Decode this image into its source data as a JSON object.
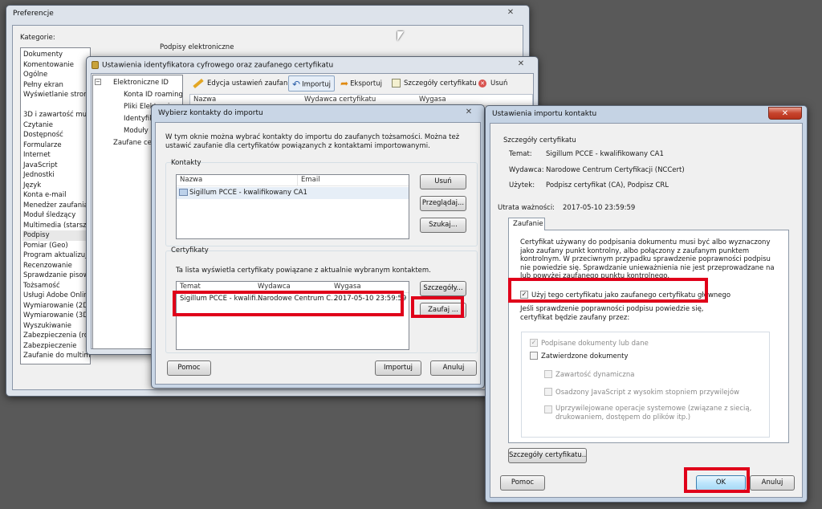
{
  "pref_window": {
    "title": "Preferencje",
    "categories_label": "Kategorie:",
    "categories": [
      "Dokumenty",
      "Komentowanie",
      "Ogólne",
      "Pełny ekran",
      "Wyświetlanie strony",
      "",
      "3D i zawartość multim",
      "Czytanie",
      "Dostępność",
      "Formularze",
      "Internet",
      "JavaScript",
      "Jednostki",
      "Język",
      "Konta e-mail",
      "Menedżer zaufania",
      "Moduł śledzący",
      "Multimedia (starsze)",
      "Podpisy",
      "Pomiar (Geo)",
      "Program aktualizujący",
      "Recenzowanie",
      "Sprawdzanie pisowni",
      "Tożsamość",
      "Usługi Adobe Online",
      "Wymiarowanie (2D)",
      "Wymiarowanie (3D)",
      "Wyszukiwanie",
      "Zabezpieczenia (rozsz",
      "Zabezpieczenie",
      "Zaufanie do multimed"
    ],
    "selected_category": "Podpisy",
    "section_title": "Podpisy elektroniczne"
  },
  "id_window": {
    "title": "Ustawienia identyfikatora cyfrowego oraz zaufanego certyfikatu",
    "tree": [
      "Elektroniczne ID",
      "Konta ID roamingu",
      "Pliki Elektroniczne ID",
      "Identyfikatory",
      "Moduły i ż",
      "Zaufane certy"
    ],
    "toolbar": {
      "edit": "Edycja ustawień zaufania",
      "import": "Importuj",
      "export": "Eksportuj",
      "details": "Szczegóły certyfikatu",
      "remove": "Usuń"
    },
    "columns": [
      "Nazwa",
      "Wydawca certyfikatu",
      "Wygasa"
    ]
  },
  "import_window": {
    "title": "Wybierz kontakty do importu",
    "intro": "W tym oknie można wybrać kontakty do importu do zaufanych tożsamości. Można też ustawić zaufanie dla certyfikatów powiązanych z kontaktami importowanymi.",
    "contacts_label": "Kontakty",
    "contacts_columns": [
      "Nazwa",
      "Email"
    ],
    "contacts": [
      {
        "name": "Sigillum PCCE - kwalifikowany CA1",
        "email": ""
      }
    ],
    "btn_remove": "Usuń",
    "btn_browse": "Przeglądaj...",
    "btn_search": "Szukaj...",
    "certs_label": "Certyfikaty",
    "certs_desc": "Ta lista wyświetla certyfikaty powiązane z aktualnie wybranym kontaktem.",
    "certs_columns": [
      "Temat",
      "Wydawca",
      "Wygasa"
    ],
    "certs": [
      {
        "subject": "Sigillum PCCE - kwalifi...",
        "issuer": "Narodowe Centrum C...",
        "expires": "2017-05-10 23:59:59"
      }
    ],
    "btn_details": "Szczegóły...",
    "btn_trust": "Zaufaj ...",
    "btn_help": "Pomoc",
    "btn_import": "Importuj",
    "btn_cancel": "Anuluj"
  },
  "settings_window": {
    "title": "Ustawienia importu kontaktu",
    "details_label": "Szczegóły certyfikatu",
    "subject_label": "Temat:",
    "subject_value": "Sigillum PCCE - kwalifikowany CA1",
    "issuer_label": "Wydawca:",
    "issuer_value": "Narodowe Centrum Certyfikacji (NCCert)",
    "usage_label": "Użytek:",
    "usage_value": "Podpisz certyfikat (CA), Podpisz CRL",
    "expiry_label": "Utrata ważności:",
    "expiry_value": "2017-05-10 23:59:59",
    "tab_trust": "Zaufanie",
    "trust_text": "Certyfikat używany do podpisania dokumentu musi być albo wyznaczony jako zaufany punkt kontrolny, albo połączony z zaufanym punktem kontrolnym. W przeciwnym przypadku sprawdzenie poprawności podpisu nie powiedzie się. Sprawdzanie unieważnienia nie jest przeprowadzane na lub powyżej zaufanego punktu kontrolnego.",
    "root_checkbox": "Użyj tego certyfikatu jako zaufanego certyfikatu głównego",
    "root_checked": true,
    "validation_text": "Jeśli sprawdzenie poprawności podpisu powiedzie się, certyfikat będzie zaufany przez:",
    "opt_signed": "Podpisane dokumenty lub dane",
    "opt_certified": "Zatwierdzone dokumenty",
    "opt_dynamic": "Zawartość dynamiczna",
    "opt_js": "Osadzony JavaScript z wysokim stopniem przywilejów",
    "opt_system": "Uprzywilejowane operacje systemowe (związane z siecią, drukowaniem, dostępem do plików itp.)",
    "btn_cert_details": "Szczegóły certyfikatu...",
    "btn_help": "Pomoc",
    "btn_ok": "OK",
    "btn_cancel": "Anuluj"
  },
  "colors": {
    "highlight_box": "#e0001a",
    "selection": "#cde8ff",
    "desktop": "#595959"
  }
}
